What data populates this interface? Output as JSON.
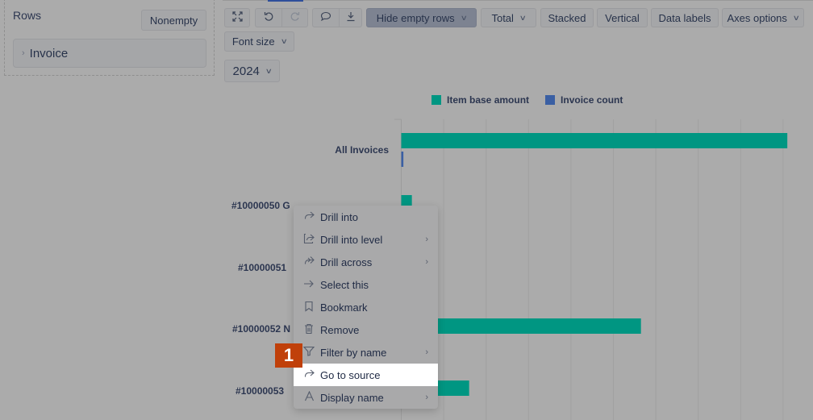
{
  "left_panel": {
    "section_title": "Rows",
    "nonempty_label": "Nonempty",
    "dimension_pill": "Invoice"
  },
  "toolbar": {
    "icons": [
      "expand-icon",
      "undo-icon",
      "redo-icon",
      "comment-icon",
      "download-icon"
    ],
    "hide_empty_rows": "Hide empty rows",
    "total": "Total",
    "stacked": "Stacked",
    "vertical": "Vertical",
    "data_labels": "Data labels",
    "axes_options": "Axes options",
    "font_size": "Font size",
    "year_filter": "2024"
  },
  "colors": {
    "item_base_amount": "#009682",
    "invoice_count": "#3a5fa3",
    "marker": "#c0400a"
  },
  "chart_data": {
    "type": "bar",
    "orientation": "horizontal",
    "title": "",
    "xlabel": "",
    "ylabel": "",
    "legend": [
      "Item base amount",
      "Invoice count"
    ],
    "legend_position": "top",
    "grid": true,
    "categories": [
      "All Invoices",
      "#10000050 G",
      "#10000051",
      "#10000052 N",
      "#10000053"
    ],
    "series": [
      {
        "name": "Item base amount",
        "values": [
          9.1,
          0.25,
          null,
          5.65,
          1.6
        ]
      },
      {
        "name": "Invoice count",
        "values": [
          0.05,
          null,
          null,
          null,
          null
        ]
      }
    ],
    "xlim": [
      0,
      10
    ],
    "x_unit_note": "relative scale (axis tick labels not visible)"
  },
  "context_menu": {
    "items": [
      {
        "label": "Drill into",
        "icon": "drill-into-icon",
        "submenu": false
      },
      {
        "label": "Drill into level",
        "icon": "drill-into-level-icon",
        "submenu": true
      },
      {
        "label": "Drill across",
        "icon": "drill-across-icon",
        "submenu": true
      },
      {
        "label": "Select this",
        "icon": "arrow-right-icon",
        "submenu": false
      },
      {
        "label": "Bookmark",
        "icon": "bookmark-icon",
        "submenu": false
      },
      {
        "label": "Remove",
        "icon": "trash-icon",
        "submenu": false
      },
      {
        "label": "Filter by name",
        "icon": "filter-icon",
        "submenu": true
      },
      {
        "label": "Go to source",
        "icon": "go-to-source-icon",
        "submenu": false,
        "highlighted": true
      },
      {
        "label": "Display name",
        "icon": "text-icon",
        "submenu": true
      }
    ]
  },
  "annotation_marker": "1"
}
